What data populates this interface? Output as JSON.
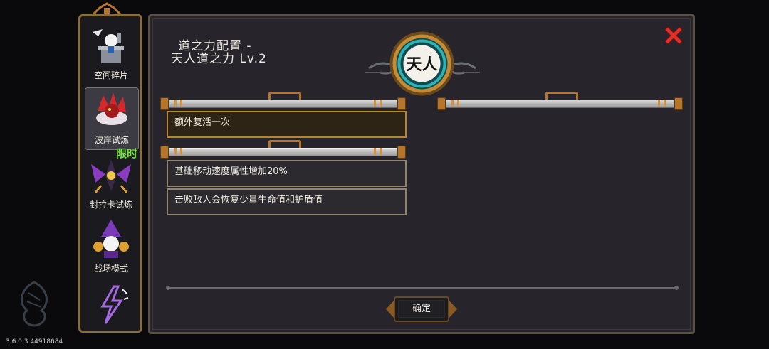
{
  "version": "3.6.0.3 44918684",
  "sidebar": {
    "items": [
      {
        "label": "空间碎片",
        "icon": "space-fragment-icon"
      },
      {
        "label": "波岸试炼",
        "icon": "red-creature-icon"
      },
      {
        "label": "封拉卡试炼",
        "icon": "purple-winged-icon",
        "badge": "限时"
      },
      {
        "label": "战场模式",
        "icon": "wizard-crystal-icon"
      },
      {
        "label": "",
        "icon": "lightning-icon"
      }
    ]
  },
  "panel": {
    "title_line1": "道之力配置 -",
    "title_line2": "天人道之力 Lv.2",
    "emblem_glyph": "天人",
    "emblem_icon": "tianren-emblem-icon",
    "close_icon": "close-x-icon"
  },
  "options": [
    {
      "text": "额外复活一次",
      "selected": true
    },
    {
      "text": "基础移动速度属性增加20%",
      "selected": false
    },
    {
      "text": "击败敌人会恢复少量生命值和护盾值",
      "selected": false
    }
  ],
  "confirm_label": "确定",
  "colors": {
    "accent_gold": "#b8852c",
    "close_red": "#e0302a",
    "limited_green": "#7de04a",
    "emblem_teal": "#1f8b8e"
  }
}
